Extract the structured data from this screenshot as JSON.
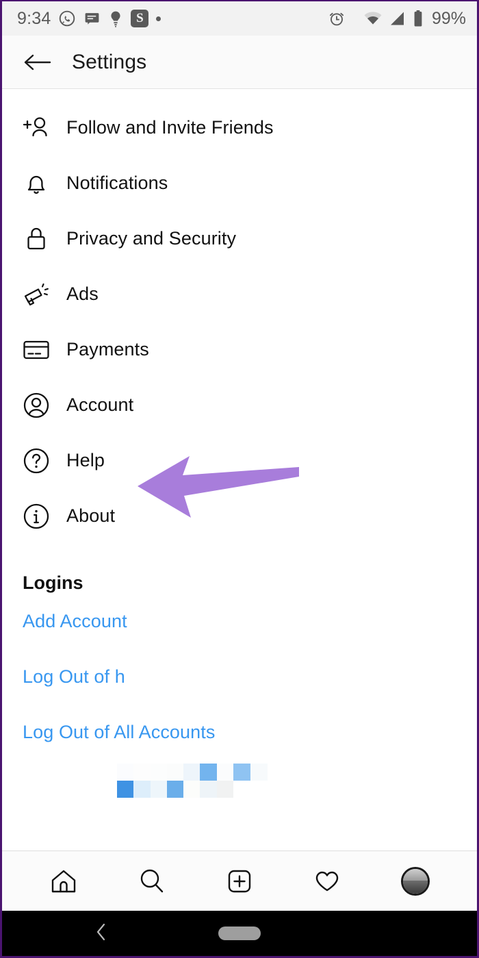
{
  "status_bar": {
    "time": "9:34",
    "battery_percent": "99%",
    "left_icons": [
      "whatsapp-icon",
      "message-icon",
      "bulb-icon",
      "s-app-icon",
      "dot-icon"
    ],
    "s_app_letter": "S",
    "right_icons": [
      "alarm-icon",
      "wifi-icon",
      "signal-icon",
      "battery-icon"
    ]
  },
  "header": {
    "title": "Settings",
    "back_icon": "back-arrow-icon"
  },
  "menu": {
    "items": [
      {
        "label": "Follow and Invite Friends",
        "icon": "person-add-icon"
      },
      {
        "label": "Notifications",
        "icon": "bell-icon"
      },
      {
        "label": "Privacy and Security",
        "icon": "lock-icon"
      },
      {
        "label": "Ads",
        "icon": "megaphone-icon"
      },
      {
        "label": "Payments",
        "icon": "credit-card-icon"
      },
      {
        "label": "Account",
        "icon": "account-circle-icon"
      },
      {
        "label": "Help",
        "icon": "question-circle-icon"
      },
      {
        "label": "About",
        "icon": "info-circle-icon"
      }
    ]
  },
  "logins": {
    "section_title": "Logins",
    "add_account": "Add Account",
    "log_out_user": "Log Out of h",
    "log_out_all": "Log Out of All Accounts"
  },
  "annotation": {
    "arrow_color": "#a87ddb",
    "points_at": "Account"
  },
  "bottom_nav": {
    "items": [
      {
        "icon": "home-icon",
        "label": "Home"
      },
      {
        "icon": "search-icon",
        "label": "Search"
      },
      {
        "icon": "add-post-icon",
        "label": "New Post"
      },
      {
        "icon": "heart-icon",
        "label": "Activity"
      },
      {
        "icon": "profile-avatar",
        "label": "Profile"
      }
    ]
  },
  "system_nav": {
    "back_icon": "system-back-icon",
    "home_pill": "system-home-pill"
  },
  "colors": {
    "link_blue": "#3897f0",
    "text_dark": "#111111",
    "status_gray": "#5a5a5a",
    "frame_purple": "#4b1470"
  }
}
